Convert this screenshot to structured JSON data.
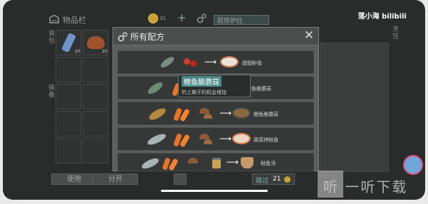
{
  "background": {
    "inventory_title": "物品栏",
    "coin_count": "31",
    "plus": "+",
    "stove_label": "厨房炉灶",
    "slot_counts": [
      "20",
      "20"
    ],
    "buttons": [
      "使用",
      "分开"
    ],
    "left_labels": [
      "背包",
      "装备"
    ],
    "right_label": "烹饪"
  },
  "watermark": "落小海 bilibili",
  "modal": {
    "title": "所有配方",
    "close": "✕",
    "recipes": [
      {
        "name": "甜甜鲈鱼"
      },
      {
        "name": "鲈鱼酿蘑菇"
      },
      {
        "name": "鲤鱼酿蘑菇"
      },
      {
        "name": "蔬菜烤鲑鱼"
      },
      {
        "name": "鲑鱼汤"
      }
    ],
    "tooltip": {
      "title": "鲤鱼酿蘑菇",
      "desc": "钓上箱子的机会增加"
    }
  },
  "skip": {
    "label": "跳过",
    "count": "21"
  },
  "logo_text": "听 一听下载",
  "colors": {
    "accent": "#4b8a88",
    "panel": "#5b5f5e",
    "row": "#353837"
  }
}
